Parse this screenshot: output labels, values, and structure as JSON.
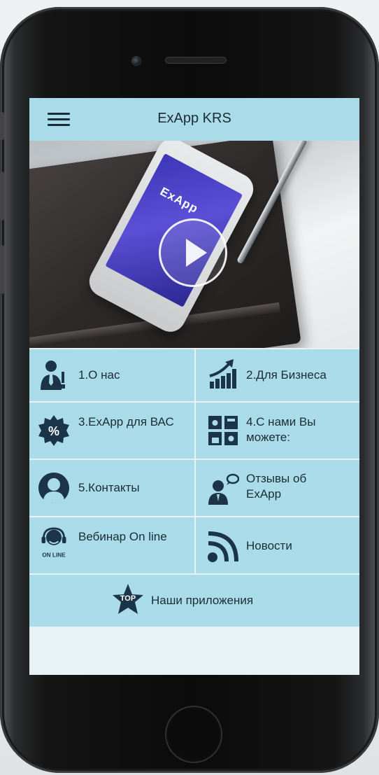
{
  "app": {
    "title": "ExApp KRS"
  },
  "hero": {
    "brand_text": "ExApp"
  },
  "menu": [
    {
      "label": "1.О нас",
      "icon": "business-person-icon"
    },
    {
      "label": "2.Для Бизнеса",
      "icon": "growth-chart-icon"
    },
    {
      "label": "3.ExApp для ВАС",
      "icon": "discount-badge-icon"
    },
    {
      "label": "4.С нами Вы можете:",
      "icon": "puzzle-blocks-icon"
    },
    {
      "label": "5.Контакты",
      "icon": "contact-person-icon"
    },
    {
      "label": "Отзывы об ExApp",
      "icon": "reviews-person-icon"
    },
    {
      "label": "Вебинар On line",
      "icon": "webinar-headset-icon"
    },
    {
      "label": "Новости",
      "icon": "rss-icon"
    }
  ],
  "bottom": {
    "label": "Наши приложения",
    "icon": "top-star-icon",
    "icon_text": "TOP"
  },
  "webinar_icon_text": "ON LINE",
  "colors": {
    "accent": "#a9dce8",
    "icon": "#1b3448",
    "text": "#1c2b35"
  }
}
